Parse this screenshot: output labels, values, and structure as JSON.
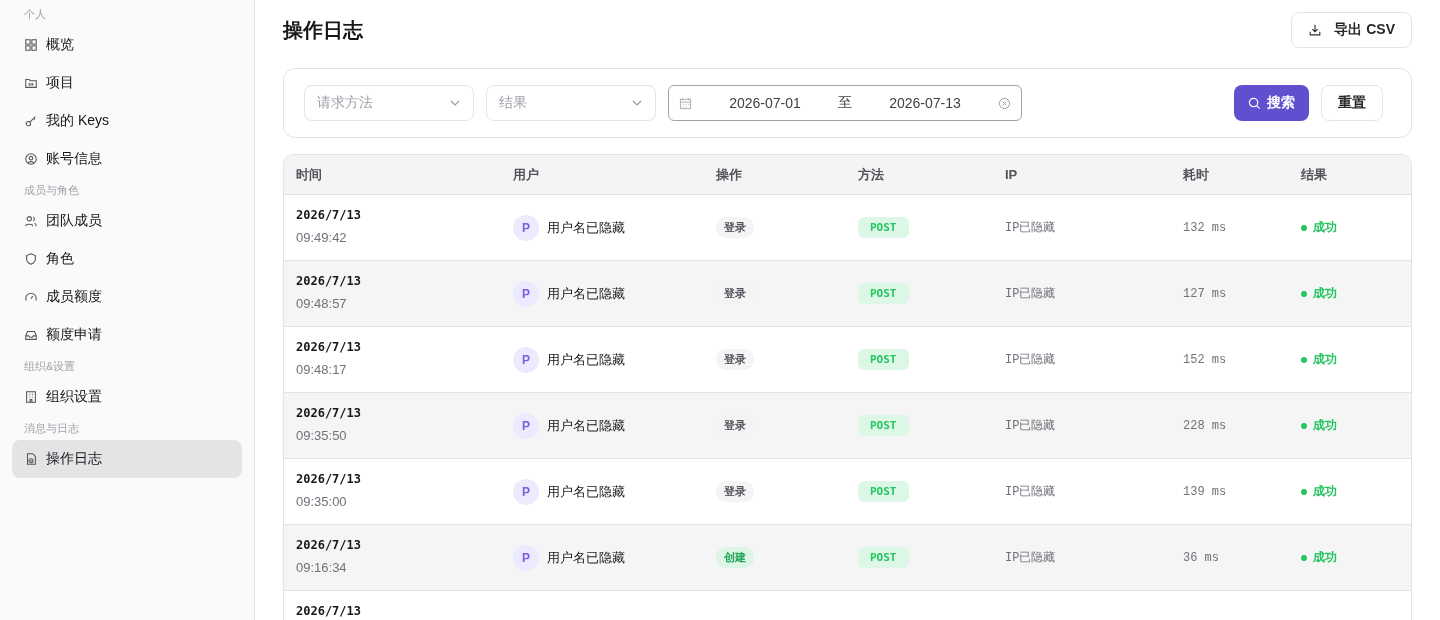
{
  "sidebar": {
    "groups": [
      {
        "heading": "个人",
        "items": [
          {
            "label": "概览",
            "selected": false
          },
          {
            "label": "项目",
            "selected": false
          },
          {
            "label": "我的 Keys",
            "selected": false
          },
          {
            "label": "账号信息",
            "selected": false
          }
        ]
      },
      {
        "heading": "成员与角色",
        "items": [
          {
            "label": "团队成员",
            "selected": false
          },
          {
            "label": "角色",
            "selected": false
          },
          {
            "label": "成员额度",
            "selected": false
          },
          {
            "label": "额度申请",
            "selected": false
          }
        ]
      },
      {
        "heading": "组织&设置",
        "items": [
          {
            "label": "组织设置",
            "selected": false
          }
        ]
      },
      {
        "heading": "消息与日志",
        "items": [
          {
            "label": "操作日志",
            "selected": true
          }
        ]
      }
    ]
  },
  "page": {
    "title": "操作日志",
    "export_button": "导出 CSV"
  },
  "filters": {
    "method": {
      "placeholder": "请求方法"
    },
    "result": {
      "placeholder": "结果"
    },
    "date_range": {
      "start": "2026-07-01",
      "separator": "至",
      "end": "2026-07-13"
    },
    "search_button": "搜索",
    "reset_button": "重置"
  },
  "table": {
    "columns": [
      "时间",
      "用户",
      "操作",
      "方法",
      "IP",
      "耗时",
      "结果"
    ],
    "rows": [
      {
        "date": "2026/7/13",
        "time": "09:49:42",
        "avatar": "P",
        "user": "用户名已隐藏",
        "action": "登录",
        "kind": "login",
        "method": "POST",
        "ip": "IP已隐藏",
        "duration": "132 ms",
        "result": "成功"
      },
      {
        "date": "2026/7/13",
        "time": "09:48:57",
        "avatar": "P",
        "user": "用户名已隐藏",
        "action": "登录",
        "kind": "login",
        "method": "POST",
        "ip": "IP已隐藏",
        "duration": "127 ms",
        "result": "成功"
      },
      {
        "date": "2026/7/13",
        "time": "09:48:17",
        "avatar": "P",
        "user": "用户名已隐藏",
        "action": "登录",
        "kind": "login",
        "method": "POST",
        "ip": "IP已隐藏",
        "duration": "152 ms",
        "result": "成功"
      },
      {
        "date": "2026/7/13",
        "time": "09:35:50",
        "avatar": "P",
        "user": "用户名已隐藏",
        "action": "登录",
        "kind": "login",
        "method": "POST",
        "ip": "IP已隐藏",
        "duration": "228 ms",
        "result": "成功"
      },
      {
        "date": "2026/7/13",
        "time": "09:35:00",
        "avatar": "P",
        "user": "用户名已隐藏",
        "action": "登录",
        "kind": "login",
        "method": "POST",
        "ip": "IP已隐藏",
        "duration": "139 ms",
        "result": "成功"
      },
      {
        "date": "2026/7/13",
        "time": "09:16:34",
        "avatar": "P",
        "user": "用户名已隐藏",
        "action": "创建",
        "kind": "create",
        "method": "POST",
        "ip": "IP已隐藏",
        "duration": "36 ms",
        "result": "成功"
      },
      {
        "date": "2026/7/13"
      }
    ]
  }
}
